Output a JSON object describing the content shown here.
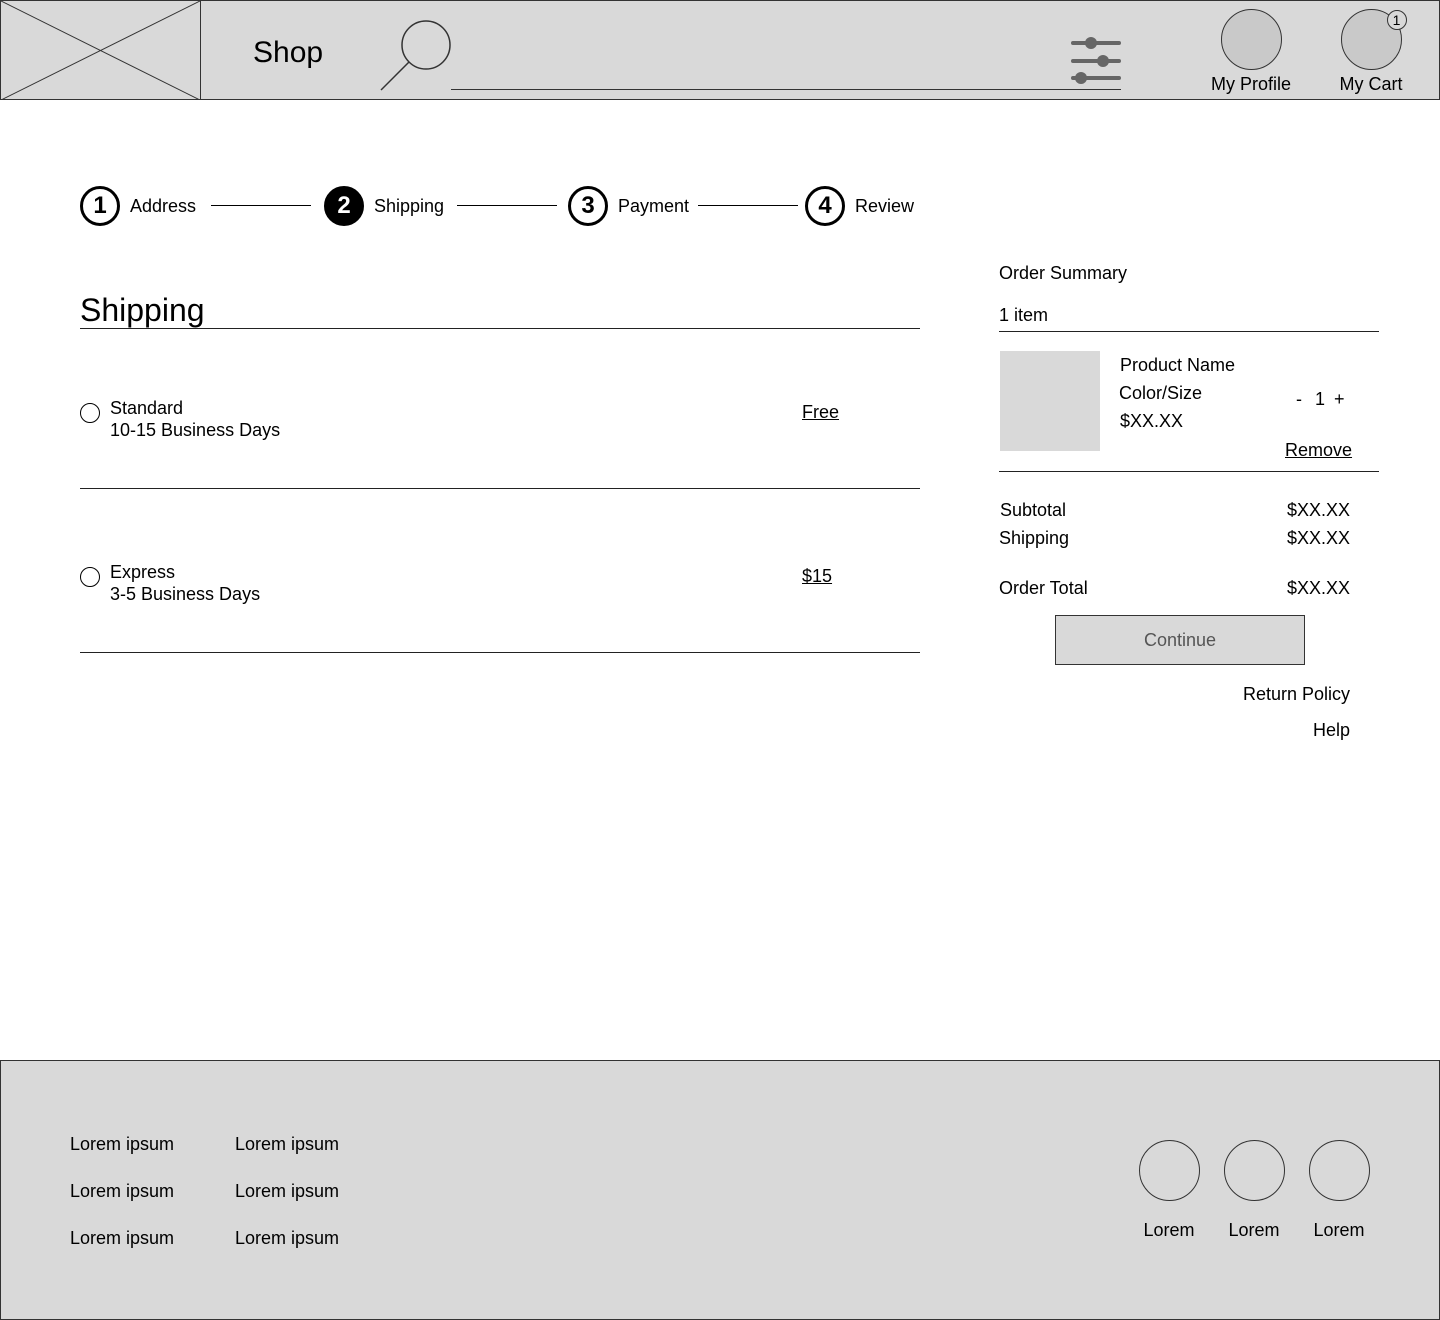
{
  "header": {
    "title": "Shop",
    "profile_label": "My Profile",
    "cart_label": "My Cart",
    "cart_count": "1",
    "icons": {
      "logo": "image-placeholder-icon",
      "search": "search-icon",
      "filter": "filter-sliders-icon"
    }
  },
  "stepper": {
    "steps": [
      {
        "number": "1",
        "label": "Address",
        "active": false
      },
      {
        "number": "2",
        "label": "Shipping",
        "active": true
      },
      {
        "number": "3",
        "label": "Payment",
        "active": false
      },
      {
        "number": "4",
        "label": "Review",
        "active": false
      }
    ]
  },
  "shipping": {
    "title": "Shipping",
    "options": [
      {
        "name": "Standard",
        "days": "10-15 Business Days",
        "price": "Free",
        "selected": false
      },
      {
        "name": "Express",
        "days": "3-5 Business Days",
        "price": "$15",
        "selected": false
      }
    ]
  },
  "summary": {
    "title": "Order Summary",
    "item_count": "1 item",
    "product": {
      "name": "Product Name",
      "variant": "Color/Size",
      "price": "$XX.XX",
      "qty_minus": "-",
      "quantity": "1",
      "qty_plus": "+",
      "remove_label": "Remove"
    },
    "subtotal_label": "Subtotal",
    "subtotal_value": "$XX.XX",
    "shipping_label": "Shipping",
    "shipping_value": "$XX.XX",
    "total_label": "Order Total",
    "total_value": "$XX.XX",
    "continue_label": "Continue",
    "return_policy_label": "Return Policy",
    "help_label": "Help"
  },
  "footer": {
    "columns": [
      [
        "Lorem ipsum",
        "Lorem ipsum",
        "Lorem ipsum"
      ],
      [
        "Lorem ipsum",
        "Lorem ipsum",
        "Lorem ipsum"
      ]
    ],
    "social": [
      "Lorem",
      "Lorem",
      "Lorem"
    ]
  },
  "colors": {
    "panel_gray": "#d9d9d9",
    "border": "#333333",
    "active_step": "#000000"
  }
}
